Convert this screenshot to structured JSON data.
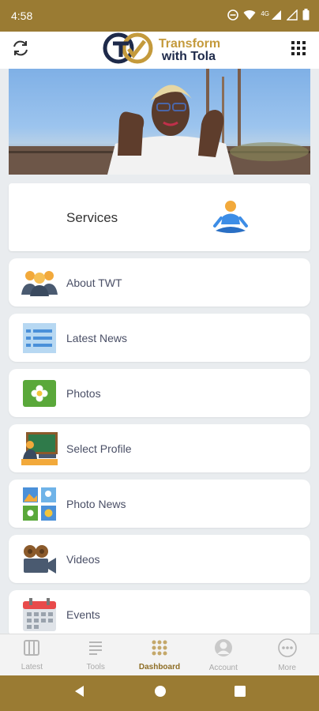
{
  "status_bar": {
    "time": "4:58",
    "network": "4G"
  },
  "app_bar": {
    "logo_line1": "Transform",
    "logo_line2": "with Tola"
  },
  "services": {
    "label": "Services"
  },
  "menu": [
    {
      "label": "About TWT",
      "icon": "people-group-icon"
    },
    {
      "label": "Latest News",
      "icon": "news-list-icon"
    },
    {
      "label": "Photos",
      "icon": "photo-flower-icon"
    },
    {
      "label": "Select Profile",
      "icon": "teacher-board-icon"
    },
    {
      "label": "Photo News",
      "icon": "photo-grid-icon"
    },
    {
      "label": "Videos",
      "icon": "video-camera-icon"
    },
    {
      "label": "Events",
      "icon": "calendar-icon"
    }
  ],
  "bottom_nav": [
    {
      "label": "Latest",
      "active": false
    },
    {
      "label": "Tools",
      "active": false
    },
    {
      "label": "Dashboard",
      "active": true
    },
    {
      "label": "Account",
      "active": false
    },
    {
      "label": "More",
      "active": false
    }
  ],
  "colors": {
    "brand_gold": "#9a7b33",
    "logo_navy": "#1e2a4a",
    "active_tab": "#8d6d25"
  }
}
